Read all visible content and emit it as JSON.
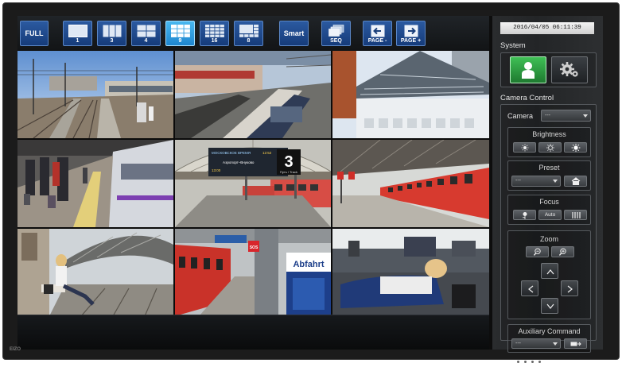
{
  "toolbar": {
    "buttons": [
      {
        "label": "FULL"
      },
      {
        "label": "1"
      },
      {
        "label": "3"
      },
      {
        "label": "4"
      },
      {
        "label": "9",
        "active": true
      },
      {
        "label": "16"
      },
      {
        "label": "8"
      },
      {
        "label": "Smart"
      },
      {
        "label": "SEQ"
      },
      {
        "label": "PAGE -"
      },
      {
        "label": "PAGE +"
      }
    ]
  },
  "side": {
    "datetime": "2016/04/05 06:11:39",
    "system_title": "System",
    "camera_control_title": "Camera Control",
    "camera_label": "Camera",
    "camera_value": "---",
    "brightness_label": "Brightness",
    "preset_label": "Preset",
    "preset_value": "---",
    "focus_label": "Focus",
    "focus_auto_label": "Auto",
    "zoom_label": "Zoom",
    "aux_label": "Auxiliary Command",
    "aux_value": "---"
  },
  "cams": {
    "board_text_1": "МОСКОВСКОЕ ВРЕМЯ",
    "board_time": "12:52",
    "board_line_2": "Аэропорт–Внуково",
    "board_line_3": "13:00",
    "board_platform": "3",
    "board_platform_label": "Путь / Track",
    "sign_abfahrt": "Abfahrt",
    "sign_sos": "SOS"
  },
  "brand": "EIZO",
  "colors": {
    "accent_blue": "#1e86cf",
    "system_green": "#2e9b3e"
  }
}
